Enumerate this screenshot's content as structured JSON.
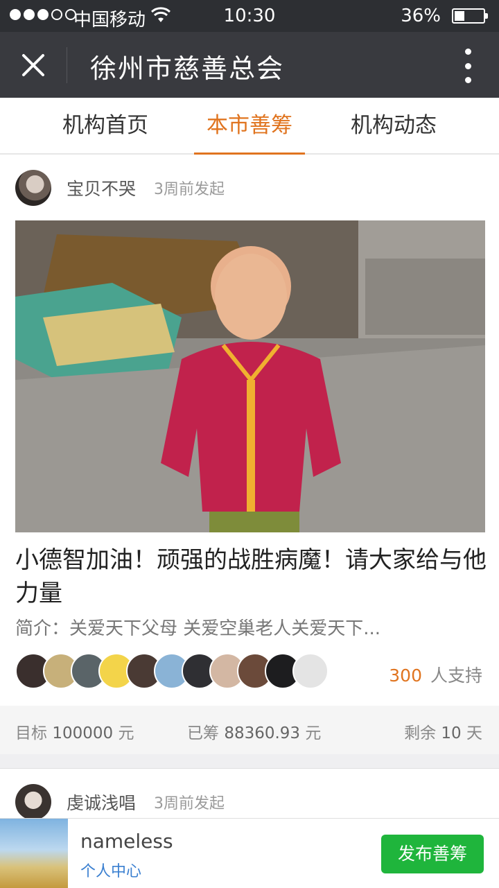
{
  "status_bar": {
    "carrier": "中国移动",
    "time": "10:30",
    "battery_percent": "36%",
    "signal_bars_filled": 3,
    "signal_bars_total": 5,
    "battery_level": 0.36
  },
  "header": {
    "title": "徐州市慈善总会"
  },
  "tabs": [
    {
      "label": "机构首页",
      "active": false
    },
    {
      "label": "本市善筹",
      "active": true
    },
    {
      "label": "机构动态",
      "active": false
    }
  ],
  "cards": [
    {
      "author": "宝贝不哭",
      "time": "3周前发起",
      "title": "小德智加油！顽强的战胜病魔！请大家给与他力量",
      "description": "简介：关爱天下父母 关爱空巢老人关爱天下...",
      "supporters_count": "300",
      "supporters_label": "人支持",
      "stats": {
        "target_label": "目标",
        "target_value": "100000",
        "raised_label": "已筹",
        "raised_value": "88360.93",
        "remaining_label": "剩余",
        "remaining_value": "10",
        "currency": "元",
        "days_unit": "天"
      }
    },
    {
      "author": "虔诚浅唱",
      "time": "3周前发起"
    }
  ],
  "bottom_bar": {
    "username": "nameless",
    "profile_link": "个人中心",
    "publish_button": "发布善筹"
  },
  "colors": {
    "accent": "#e0741f",
    "header_bg": "#393a3f",
    "status_bg": "#2d2f33",
    "green_button": "#1fb53c",
    "link_blue": "#3a7fd0"
  }
}
